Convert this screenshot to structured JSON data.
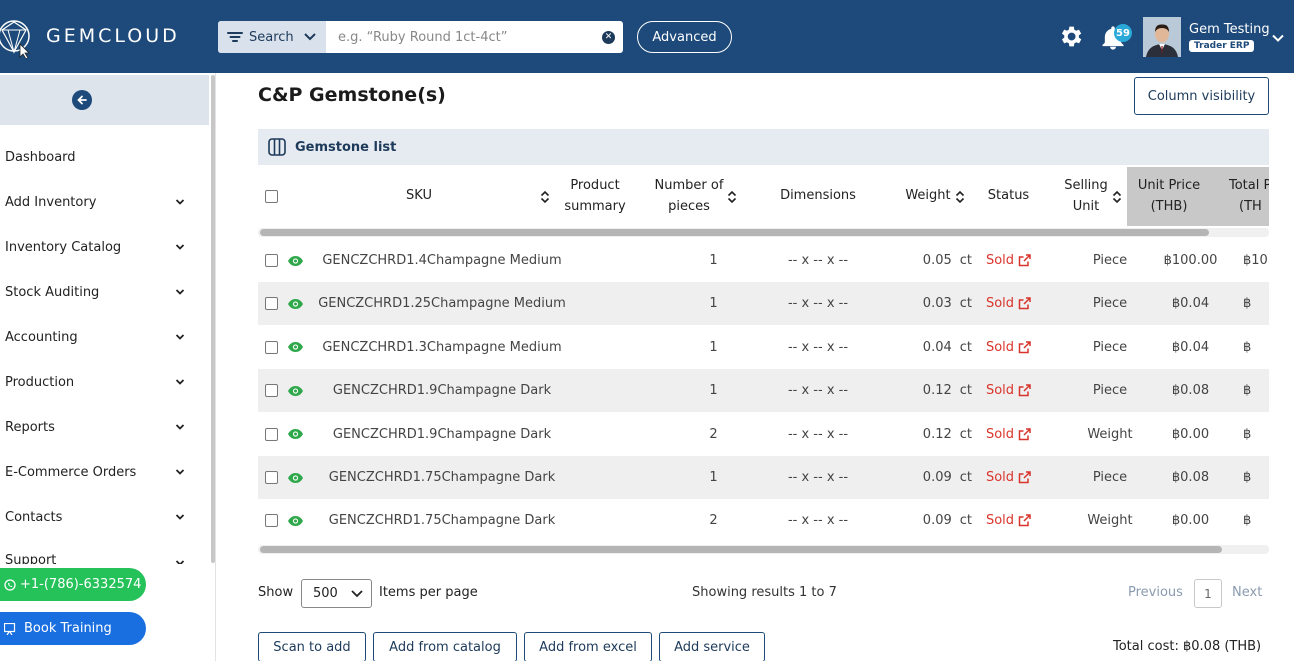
{
  "header": {
    "logo_text": "GEMCLOUD",
    "search_type_label": "Search",
    "search_placeholder": "e.g. “Ruby Round 1ct-4ct”",
    "advanced_label": "Advanced",
    "notification_count": "59",
    "user_name": "Gem Testing",
    "user_role": "Trader ERP"
  },
  "sidebar": {
    "items": [
      {
        "label": "Dashboard",
        "has_chevron": false
      },
      {
        "label": "Add Inventory",
        "has_chevron": true
      },
      {
        "label": "Inventory Catalog",
        "has_chevron": true
      },
      {
        "label": "Stock Auditing",
        "has_chevron": true
      },
      {
        "label": "Accounting",
        "has_chevron": true
      },
      {
        "label": "Production",
        "has_chevron": true
      },
      {
        "label": "Reports",
        "has_chevron": true
      },
      {
        "label": "E-Commerce Orders",
        "has_chevron": true
      },
      {
        "label": "Contacts",
        "has_chevron": true
      },
      {
        "label": "Support",
        "has_chevron": true
      }
    ],
    "whatsapp_label": "+1-(786)-6332574",
    "book_training_label": "Book Training"
  },
  "main": {
    "title": "C&P Gemstone(s)",
    "column_visibility_label": "Column visibility",
    "card_title": "Gemstone list",
    "columns": {
      "sku": "SKU",
      "product_summary_1": "Product",
      "product_summary_2": "summary",
      "pieces_1": "Number of",
      "pieces_2": "pieces",
      "dimensions": "Dimensions",
      "weight": "Weight",
      "status": "Status",
      "selling_unit_1": "Selling",
      "selling_unit_2": "Unit",
      "unit_price_1": "Unit Price",
      "unit_price_2": "(THB)",
      "total_price_1": "Total P",
      "total_price_2": "(TH"
    },
    "rows": [
      {
        "sku": "GENCZCHRD1.4Champagne Medium",
        "pieces": "1",
        "dimensions": "-- x -- x --",
        "weight": "0.05",
        "unit": "ct",
        "status": "Sold",
        "selling_unit": "Piece",
        "unit_price": "฿100.00",
        "total_price": "฿10"
      },
      {
        "sku": "GENCZCHRD1.25Champagne Medium",
        "pieces": "1",
        "dimensions": "-- x -- x --",
        "weight": "0.03",
        "unit": "ct",
        "status": "Sold",
        "selling_unit": "Piece",
        "unit_price": "฿0.04",
        "total_price": "฿"
      },
      {
        "sku": "GENCZCHRD1.3Champagne Medium",
        "pieces": "1",
        "dimensions": "-- x -- x --",
        "weight": "0.04",
        "unit": "ct",
        "status": "Sold",
        "selling_unit": "Piece",
        "unit_price": "฿0.04",
        "total_price": "฿"
      },
      {
        "sku": "GENCZCHRD1.9Champagne Dark",
        "pieces": "1",
        "dimensions": "-- x -- x --",
        "weight": "0.12",
        "unit": "ct",
        "status": "Sold",
        "selling_unit": "Piece",
        "unit_price": "฿0.08",
        "total_price": "฿"
      },
      {
        "sku": "GENCZCHRD1.9Champagne Dark",
        "pieces": "2",
        "dimensions": "-- x -- x --",
        "weight": "0.12",
        "unit": "ct",
        "status": "Sold",
        "selling_unit": "Weight",
        "unit_price": "฿0.00",
        "total_price": "฿"
      },
      {
        "sku": "GENCZCHRD1.75Champagne Dark",
        "pieces": "1",
        "dimensions": "-- x -- x --",
        "weight": "0.09",
        "unit": "ct",
        "status": "Sold",
        "selling_unit": "Piece",
        "unit_price": "฿0.08",
        "total_price": "฿"
      },
      {
        "sku": "GENCZCHRD1.75Champagne Dark",
        "pieces": "2",
        "dimensions": "-- x -- x --",
        "weight": "0.09",
        "unit": "ct",
        "status": "Sold",
        "selling_unit": "Weight",
        "unit_price": "฿0.00",
        "total_price": "฿"
      }
    ],
    "pagination": {
      "show_label": "Show",
      "per_page_value": "500",
      "per_page_options": [
        "500"
      ],
      "items_per_page_label": "Items per page",
      "results_text": "Showing results 1 to 7",
      "previous_label": "Previous",
      "current_page": "1",
      "next_label": "Next"
    },
    "actions": {
      "scan_label": "Scan to add",
      "catalog_label": "Add from catalog",
      "excel_label": "Add from excel",
      "service_label": "Add service"
    },
    "total_cost_label": "Total cost:",
    "total_cost_value": "฿0.08 (THB)"
  },
  "colors": {
    "header_bg": "#1d4a7a",
    "sold_red": "#d9342b",
    "eye_green": "#2ea84a",
    "whatsapp_green": "#25c25a",
    "training_blue": "#1a6fe0"
  },
  "icons": [
    "filter-icon",
    "chevron-down-icon",
    "clear-icon",
    "gear-icon",
    "bell-icon",
    "back-arrow-icon",
    "columns-icon",
    "sort-icon",
    "eye-icon",
    "external-link-icon",
    "whatsapp-icon",
    "training-icon"
  ]
}
